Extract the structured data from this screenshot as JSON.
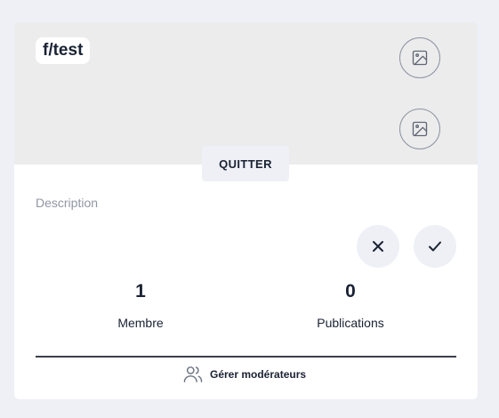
{
  "community": {
    "name": "f/test",
    "description_placeholder": "Description"
  },
  "banner": {
    "icons": [
      "image-icon",
      "image-icon"
    ]
  },
  "actions": {
    "quit_label": "QUITTER",
    "cancel_icon": "close-icon",
    "confirm_icon": "check-icon"
  },
  "stats": {
    "members_count": "1",
    "members_label": "Membre",
    "posts_count": "0",
    "posts_label": "Publications"
  },
  "moderators": {
    "label": "Gérer modérateurs",
    "icon": "users-icon"
  },
  "colors": {
    "background": "#eef0f6",
    "banner": "#ececec",
    "text": "#1a2233",
    "muted": "#9096a3"
  }
}
